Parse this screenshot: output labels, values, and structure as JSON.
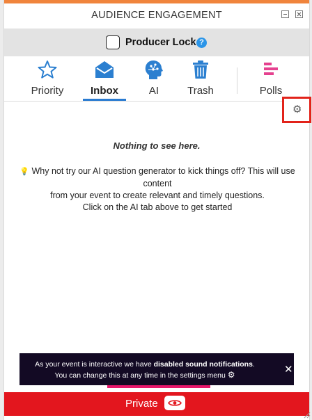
{
  "window": {
    "title": "AUDIENCE ENGAGEMENT"
  },
  "producer_lock": {
    "label": "Producer Lock",
    "help": "?"
  },
  "tabs": [
    {
      "label": "Priority",
      "icon": "star-icon"
    },
    {
      "label": "Inbox",
      "icon": "envelope-icon",
      "active": true
    },
    {
      "label": "AI",
      "icon": "ai-head-icon"
    },
    {
      "label": "Trash",
      "icon": "trash-icon"
    },
    {
      "label": "Polls",
      "icon": "polls-icon"
    }
  ],
  "empty_state": {
    "title": "Nothing to see here.",
    "line1": "Why not try our AI question generator to kick things off? This will use content",
    "line2": "from your event to create relevant and timely questions.",
    "line3": "Click on the AI tab above to get started"
  },
  "toast": {
    "prefix": "As your event is interactive we have ",
    "bold": "disabled sound notifications",
    "suffix": ".",
    "line2": "You can change this at any time in the settings menu",
    "close": "✕"
  },
  "footer": {
    "label": "Private"
  },
  "colors": {
    "accent_orange": "#f0843c",
    "icon_blue": "#2b7fd0",
    "polls_pink": "#e5418f",
    "private_red": "#e3161e",
    "highlight_red": "#e2231a",
    "toast_bg": "#130a24"
  }
}
